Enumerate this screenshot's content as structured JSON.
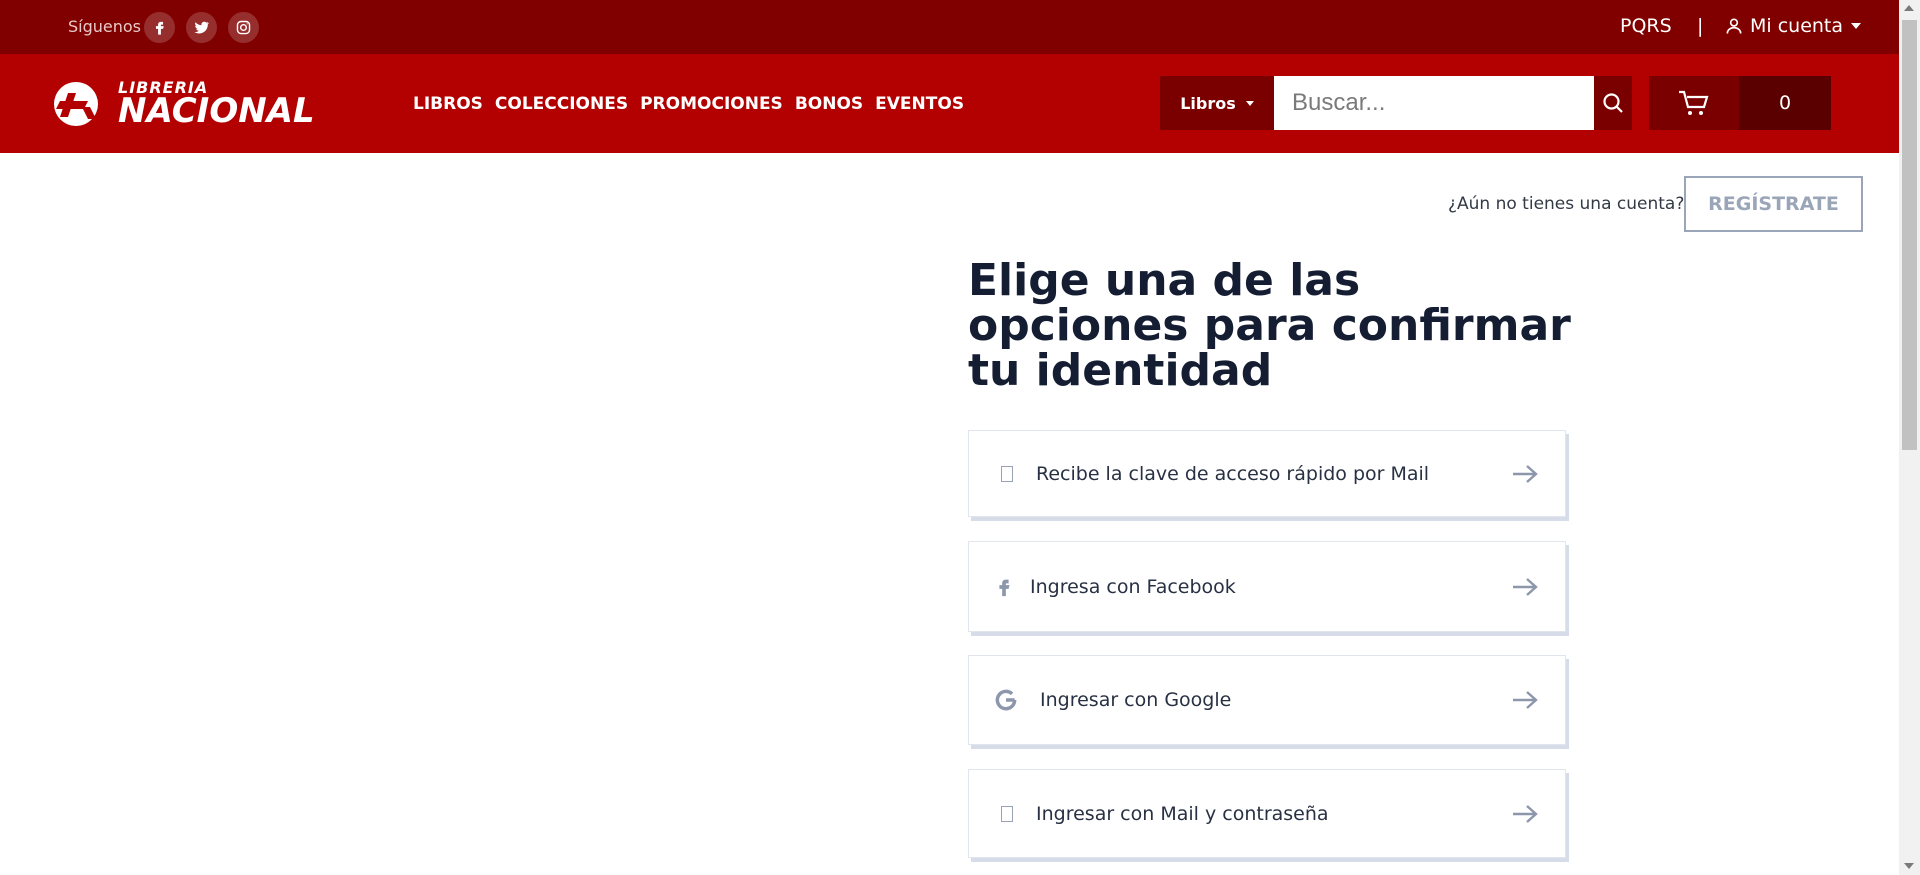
{
  "topbar": {
    "follow_label": "Síguenos",
    "social": [
      "facebook-icon",
      "twitter-icon",
      "instagram-icon"
    ],
    "pqrs_label": "PQRS",
    "separator": "|",
    "account_label": "Mi cuenta"
  },
  "header": {
    "logo_small": "LIBRERIA",
    "logo_big": "NACIONAL",
    "menu": [
      "LIBROS",
      "COLECCIONES",
      "PROMOCIONES",
      "BONOS",
      "EVENTOS"
    ],
    "search_category": "Libros",
    "search_placeholder": "Buscar...",
    "cart_count": "0"
  },
  "main": {
    "no_account_text": "¿Aún no tienes una cuenta?",
    "register_label": "REGÍSTRATE",
    "title": "Elige una de las opciones para confirmar tu identidad",
    "options": [
      {
        "label": "Recibe la clave de acceso rápido por Mail",
        "icon": "box-glyph-icon"
      },
      {
        "label": "Ingresa con Facebook",
        "icon": "facebook-icon"
      },
      {
        "label": "Ingresar con Google",
        "icon": "google-icon"
      },
      {
        "label": "Ingresar con Mail y contraseña",
        "icon": "box-glyph-icon"
      }
    ]
  },
  "colors": {
    "topbar": "#800000",
    "navbar": "#b30000",
    "dark_accent": "#7a0000",
    "title_text": "#151d33",
    "muted": "#8d97ab"
  }
}
